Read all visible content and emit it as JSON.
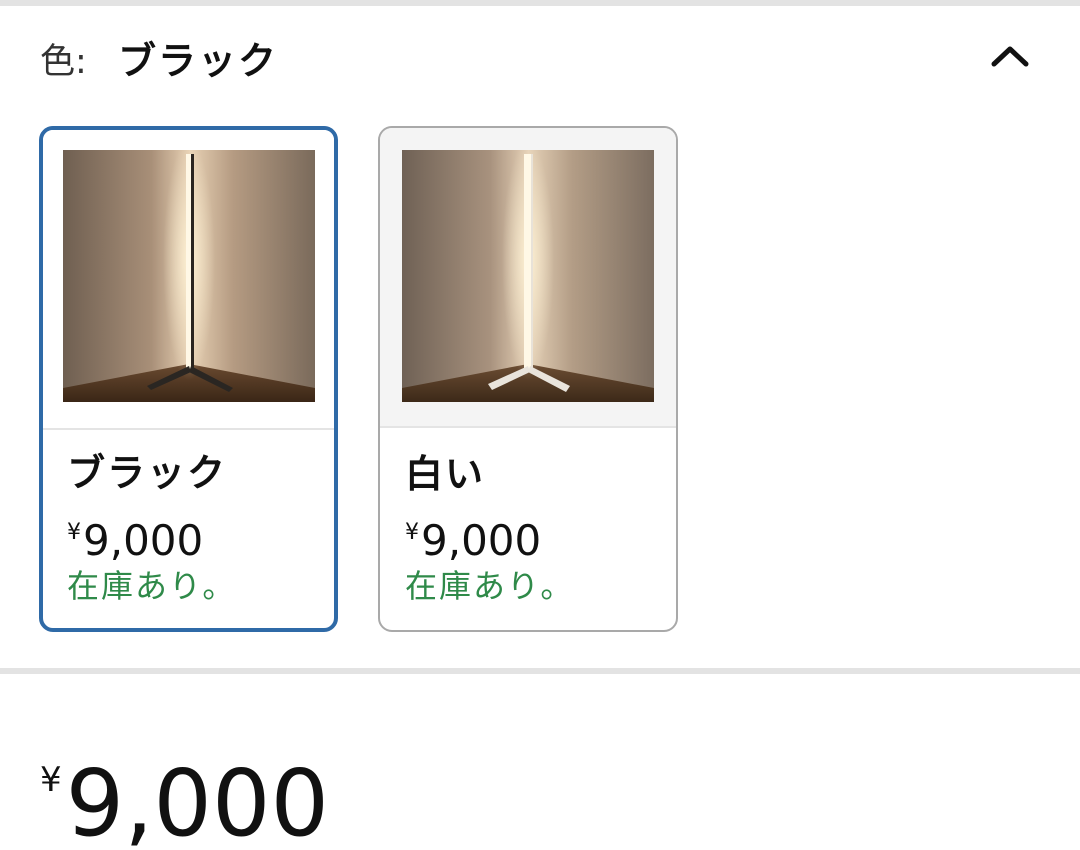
{
  "variation": {
    "label": "色:",
    "selected_value": "ブラック",
    "toggle_icon": "chevron-up-icon"
  },
  "swatches": [
    {
      "name": "ブラック",
      "currency": "¥",
      "price": "9,000",
      "stock": "在庫あり。",
      "selected": true
    },
    {
      "name": "白い",
      "currency": "¥",
      "price": "9,000",
      "stock": "在庫あり。",
      "selected": false
    }
  ],
  "main_price": {
    "currency": "¥",
    "amount": "9,000"
  },
  "colors": {
    "selected_border": "#2f6aa7",
    "in_stock": "#2f8a49",
    "divider": "#e3e3e3"
  }
}
